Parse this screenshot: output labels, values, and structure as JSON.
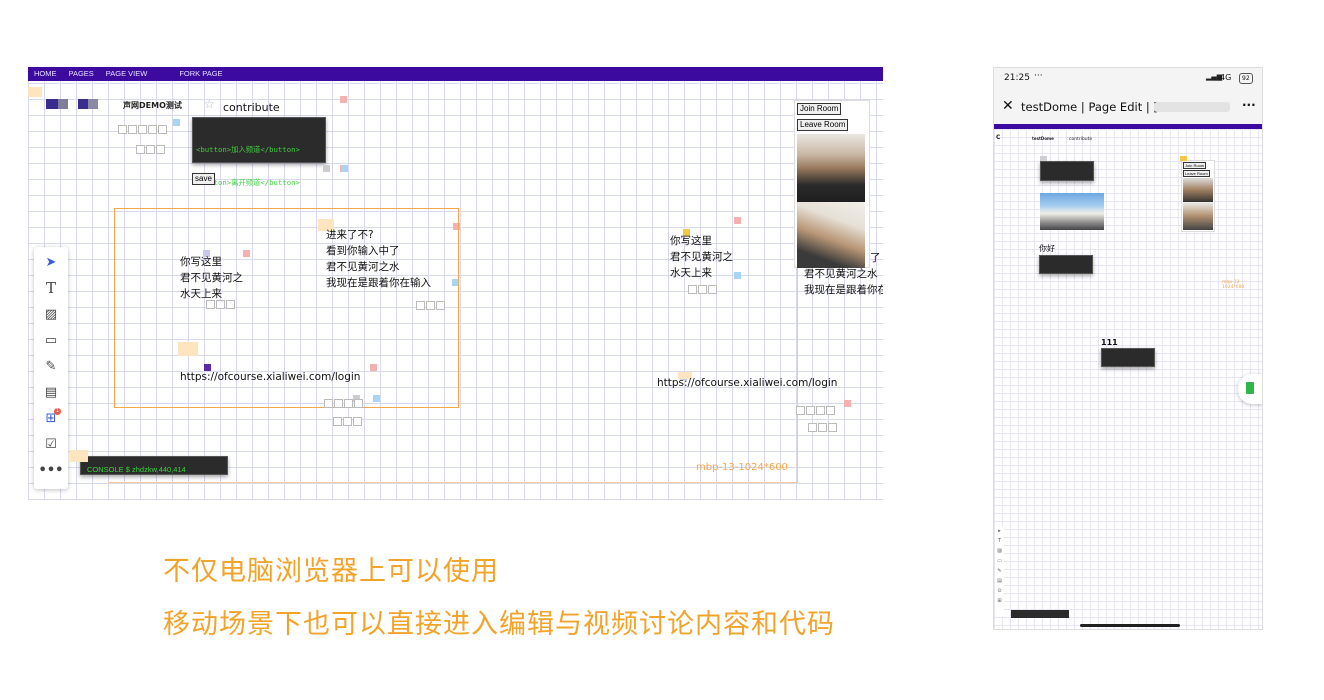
{
  "desktop": {
    "nav": [
      "HOME",
      "PAGES",
      "PAGE VIEW",
      "FORK PAGE"
    ],
    "title": "声网DEMO测试",
    "contribute": "contribute",
    "code_lines": [
      "<button>加入频道</button>",
      "<button>离开频道</button>"
    ],
    "save_label": "save",
    "join_room": "Join Room",
    "leave_room": "Leave Room",
    "note_1": "你写这里\n君不见黄河之\n水天上来",
    "note_2": "进来了不?\n看到你输入中了\n君不见黄河之水\n我现在是跟着你在输入",
    "note_3": "你写这里\n君不见黄河之\n水天上来",
    "note_4_partial_a": "了",
    "note_4": "君不见黄河之水\n我现在是跟着你在",
    "url_1": "https://ofcourse.xialiwei.com/login",
    "url_2": "https://ofcourse.xialiwei.com/login",
    "console": "CONSOLE $ zhdzkw,440,414",
    "frame_label": "mbp-13-1024*600",
    "tool_badge": "1"
  },
  "captions": {
    "line1": "不仅电脑浏览器上可以使用",
    "line2": "移动场景下也可以直接进入编辑与视频讨论内容和代码"
  },
  "mobile": {
    "time": "21:25",
    "dots": "···",
    "signal": "4G",
    "battery": "92",
    "page_title": "testDome | Page Edit | [",
    "more": "···",
    "doc_title": "testDome",
    "contribute": "contribute",
    "join_room": "Join Room",
    "leave_room": "Leave Room",
    "note_nihao": "你好",
    "note_111": "111",
    "frame_label": "mbp-13-1024*600",
    "save_label": "save"
  },
  "colors": {
    "nav": "#3d0aa0",
    "caption": "#f2a32a",
    "frame": "#f5a54a",
    "code_bg": "#2b2b2b",
    "code_fg": "#3fd03f"
  }
}
